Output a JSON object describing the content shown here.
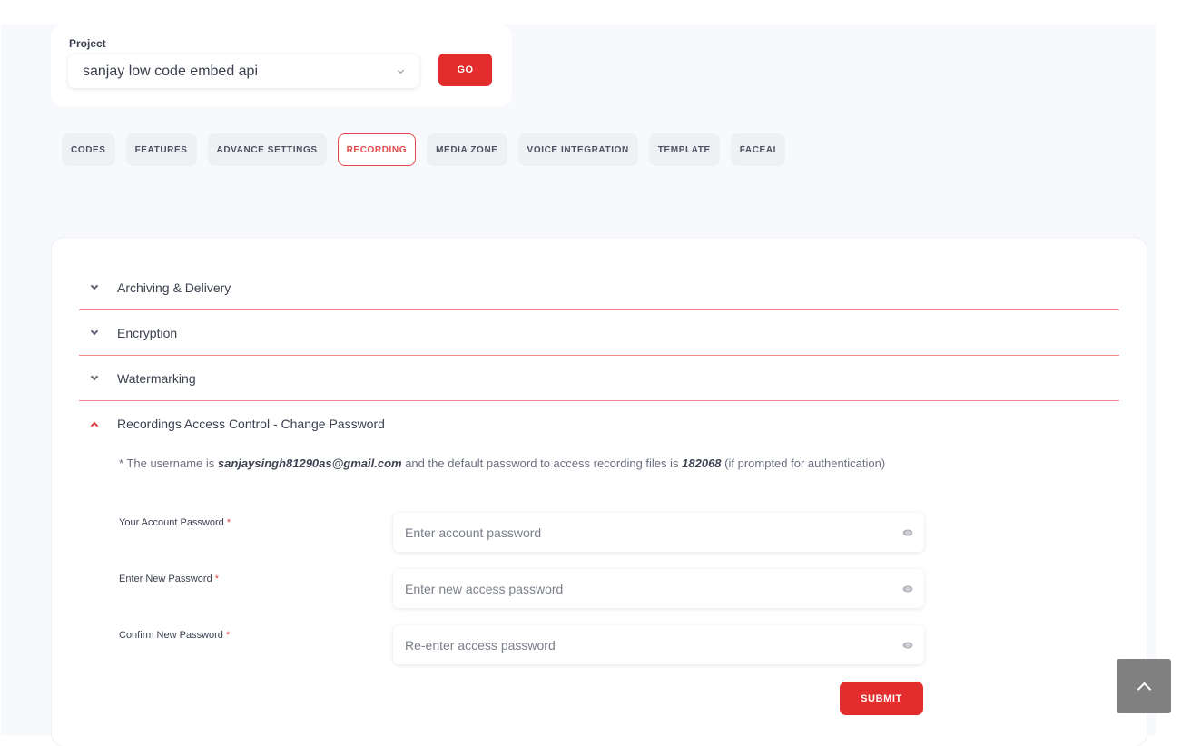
{
  "project": {
    "label": "Project",
    "selected": "sanjay low code embed api",
    "go_label": "GO"
  },
  "tabs": [
    {
      "label": "CODES",
      "active": false
    },
    {
      "label": "FEATURES",
      "active": false
    },
    {
      "label": "ADVANCE SETTINGS",
      "active": false
    },
    {
      "label": "RECORDING",
      "active": true
    },
    {
      "label": "MEDIA ZONE",
      "active": false
    },
    {
      "label": "VOICE INTEGRATION",
      "active": false
    },
    {
      "label": "TEMPLATE",
      "active": false
    },
    {
      "label": "FACEAI",
      "active": false
    }
  ],
  "accordion": [
    {
      "title": "Archiving & Delivery",
      "open": false
    },
    {
      "title": "Encryption",
      "open": false
    },
    {
      "title": "Watermarking",
      "open": false
    },
    {
      "title": "Recordings Access Control - Change Password",
      "open": true
    }
  ],
  "note": {
    "prefix": "* The username is ",
    "username": "sanjaysingh81290as@gmail.com",
    "middle": " and the default password to access recording files is ",
    "password": "182068",
    "suffix": " (if prompted for authentication)"
  },
  "form": {
    "fields": [
      {
        "label": "Your Account Password",
        "placeholder": "Enter account password",
        "value": ""
      },
      {
        "label": "Enter New Password",
        "placeholder": "Enter new access password",
        "value": ""
      },
      {
        "label": "Confirm New Password",
        "placeholder": "Re-enter access password",
        "value": ""
      }
    ],
    "required_mark": "*",
    "submit_label": "SUBMIT"
  },
  "colors": {
    "accent": "#e32d2d",
    "divider": "#f08a8a",
    "page_bg": "#f8f9fd"
  }
}
